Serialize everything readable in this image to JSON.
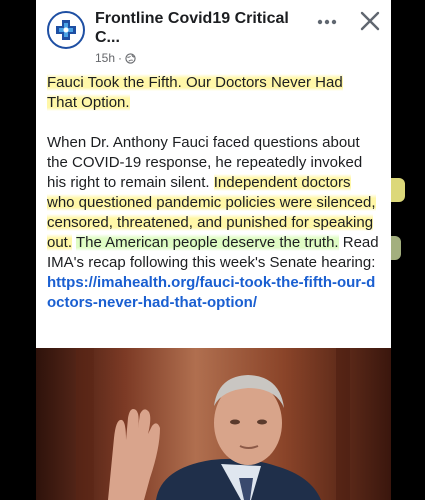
{
  "post": {
    "page_name_line1": "Frontline Covid19 Critical",
    "page_name_line2": "C...",
    "time": "15h",
    "dot": "·",
    "privacy_icon": "globe-icon",
    "more_icon": "more-icon",
    "close_icon": "close-icon",
    "headline_line1": "Fauci Took the Fifth. Our Doctors Never Had",
    "headline_line2": "That Option.",
    "body_plain_1": "When Dr. Anthony Fauci faced questions about the COVID-19 response, he repeatedly invoked his right to remain silent. ",
    "body_highlight": "Independent doctors who questioned pandemic policies were silenced, censored, threatened, and punished for speaking out.",
    "body_space": " ",
    "body_highlight_green": "The American people deserve the truth.",
    "body_plain_2": " Read IMA's recap following this week's Senate hearing:",
    "link": "https://imahealth.org/fauci-took-the-fifth-our-doctors-never-had-that-option/"
  },
  "colors": {
    "background": "#000000",
    "card": "#ffffff",
    "link": "#1a5fd1",
    "highlight_yellow": "#fff7a8",
    "highlight_green": "#dffcc4"
  }
}
